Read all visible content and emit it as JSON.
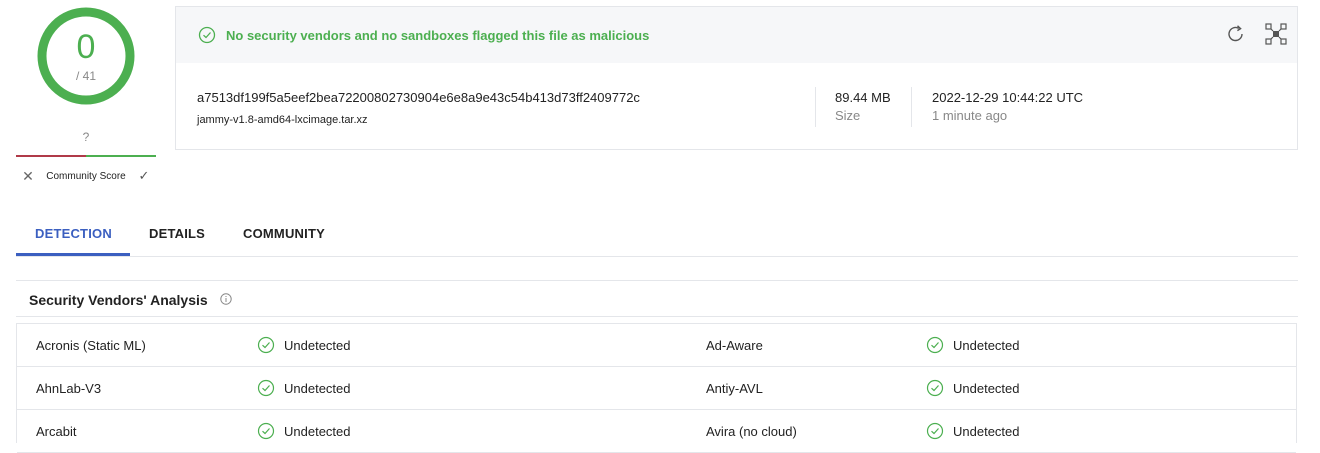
{
  "score": {
    "detections": "0",
    "total": "/ 41"
  },
  "community": {
    "unknown_mark": "?",
    "label": "Community Score",
    "dislike_icon": "close-icon",
    "like_icon": "check-icon"
  },
  "summary": {
    "banner_text": "No security vendors and no sandboxes flagged this file as malicious",
    "hash": "a7513df199f5a5eef2bea72200802730904e6e8a9e43c54b413d73ff2409772c",
    "filename": "jammy-v1.8-amd64-lxcimage.tar.xz",
    "size_value": "89.44 MB",
    "size_label": "Size",
    "date_value": "2022-12-29 10:44:22 UTC",
    "date_relative": "1 minute ago",
    "colors": {
      "clean": "#4caf50",
      "banner_bg": "#f6f7f9"
    }
  },
  "tabs": [
    {
      "label": "DETECTION",
      "active": true
    },
    {
      "label": "DETAILS",
      "active": false
    },
    {
      "label": "COMMUNITY",
      "active": false
    }
  ],
  "vendors": {
    "title": "Security Vendors' Analysis",
    "rows": [
      {
        "left_name": "Acronis (Static ML)",
        "left_result": "Undetected",
        "right_name": "Ad-Aware",
        "right_result": "Undetected"
      },
      {
        "left_name": "AhnLab-V3",
        "left_result": "Undetected",
        "right_name": "Antiy-AVL",
        "right_result": "Undetected"
      },
      {
        "left_name": "Arcabit",
        "left_result": "Undetected",
        "right_name": "Avira (no cloud)",
        "right_result": "Undetected"
      }
    ]
  },
  "accent_color": "#3b5fc0"
}
